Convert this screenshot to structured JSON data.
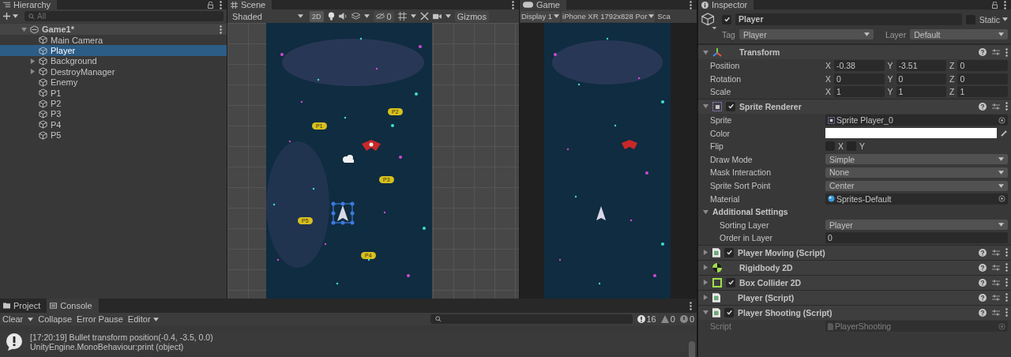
{
  "hierarchy": {
    "title": "Hierarchy",
    "search": {
      "placeholder": "All"
    },
    "root": {
      "name": "Game1*",
      "expanded": true
    },
    "items": [
      {
        "name": "Main Camera",
        "selected": false
      },
      {
        "name": "Player",
        "selected": true
      },
      {
        "name": "Background",
        "selected": false,
        "expanded": false
      },
      {
        "name": "DestroyManager",
        "selected": false,
        "expanded": false
      },
      {
        "name": "Enemy",
        "selected": false
      },
      {
        "name": "P1",
        "selected": false
      },
      {
        "name": "P2",
        "selected": false
      },
      {
        "name": "P3",
        "selected": false
      },
      {
        "name": "P4",
        "selected": false
      },
      {
        "name": "P5",
        "selected": false
      }
    ]
  },
  "scene": {
    "tab": "Scene",
    "shading": "Shaded",
    "mode_2d": "2D",
    "hidden_count": "0",
    "gizmos": "Gizmos",
    "labels": [
      {
        "text": "P1"
      },
      {
        "text": "P2"
      },
      {
        "text": "P3"
      },
      {
        "text": "P4"
      },
      {
        "text": "P5"
      }
    ]
  },
  "game": {
    "tab": "Game",
    "display": "Display 1",
    "resolution": "iPhone XR 1792x828 Por",
    "scale": "Sca"
  },
  "console": {
    "tabs": [
      {
        "label": "Project",
        "selected": false
      },
      {
        "label": "Console",
        "selected": true
      }
    ],
    "toolbar": {
      "clear": "Clear",
      "collapse": "Collapse",
      "error_pause": "Error Pause",
      "editor": "Editor"
    },
    "counts": {
      "logs": "16",
      "warnings": "0",
      "errors": "0"
    },
    "entries": [
      {
        "message": "[17:20:19] Bullet transform position(-0.4, -3.5, 0.0)",
        "trace": "UnityEngine.MonoBehaviour:print (object)"
      }
    ]
  },
  "inspector": {
    "title": "Inspector",
    "object": {
      "name": "Player",
      "active": true,
      "static": false,
      "static_label": "Static",
      "tag_label": "Tag",
      "tag": "Player",
      "layer_label": "Layer",
      "layer": "Default"
    },
    "transform": {
      "title": "Transform",
      "expanded": true,
      "rows": [
        {
          "label": "Position",
          "fields": [
            {
              "axis": "X",
              "value": "-0.38"
            },
            {
              "axis": "Y",
              "value": "-3.51"
            },
            {
              "axis": "Z",
              "value": "0"
            }
          ]
        },
        {
          "label": "Rotation",
          "fields": [
            {
              "axis": "X",
              "value": "0"
            },
            {
              "axis": "Y",
              "value": "0"
            },
            {
              "axis": "Z",
              "value": "0"
            }
          ]
        },
        {
          "label": "Scale",
          "fields": [
            {
              "axis": "X",
              "value": "1"
            },
            {
              "axis": "Y",
              "value": "1"
            },
            {
              "axis": "Z",
              "value": "1"
            }
          ]
        }
      ]
    },
    "sprite_renderer": {
      "title": "Sprite Renderer",
      "enabled": true,
      "expanded": true,
      "props": [
        {
          "kind": "object",
          "label": "Sprite",
          "value": "Sprite Player_0"
        },
        {
          "kind": "color",
          "label": "Color",
          "color": "#ffffff"
        },
        {
          "kind": "flip",
          "label": "Flip",
          "options": [
            {
              "label": "X",
              "checked": false
            },
            {
              "label": "Y",
              "checked": false
            }
          ]
        },
        {
          "kind": "dropdown",
          "label": "Draw Mode",
          "value": "Simple"
        },
        {
          "kind": "dropdown",
          "label": "Mask Interaction",
          "value": "None"
        },
        {
          "kind": "dropdown",
          "label": "Sprite Sort Point",
          "value": "Center"
        },
        {
          "kind": "material",
          "label": "Material",
          "value": "Sprites-Default"
        }
      ],
      "additional": {
        "title": "Additional Settings",
        "expanded": true,
        "props": [
          {
            "kind": "dropdown",
            "label": "Sorting Layer",
            "value": "Player"
          },
          {
            "kind": "text",
            "label": "Order in Layer",
            "value": "0"
          }
        ]
      }
    },
    "components": [
      {
        "kind": "script",
        "title": "Player Moving (Script)",
        "enabled": true,
        "expanded": false
      },
      {
        "kind": "rigidbody",
        "title": "Rigidbody 2D",
        "expanded": false
      },
      {
        "kind": "collider",
        "title": "Box Collider 2D",
        "enabled": true,
        "expanded": false
      },
      {
        "kind": "script",
        "title": "Player (Script)",
        "expanded": false
      },
      {
        "kind": "script",
        "title": "Player Shooting (Script)",
        "enabled": true,
        "expanded": true,
        "props": [
          {
            "kind": "object",
            "label": "Script",
            "value": "PlayerShooting",
            "disabled": true
          }
        ]
      }
    ]
  }
}
